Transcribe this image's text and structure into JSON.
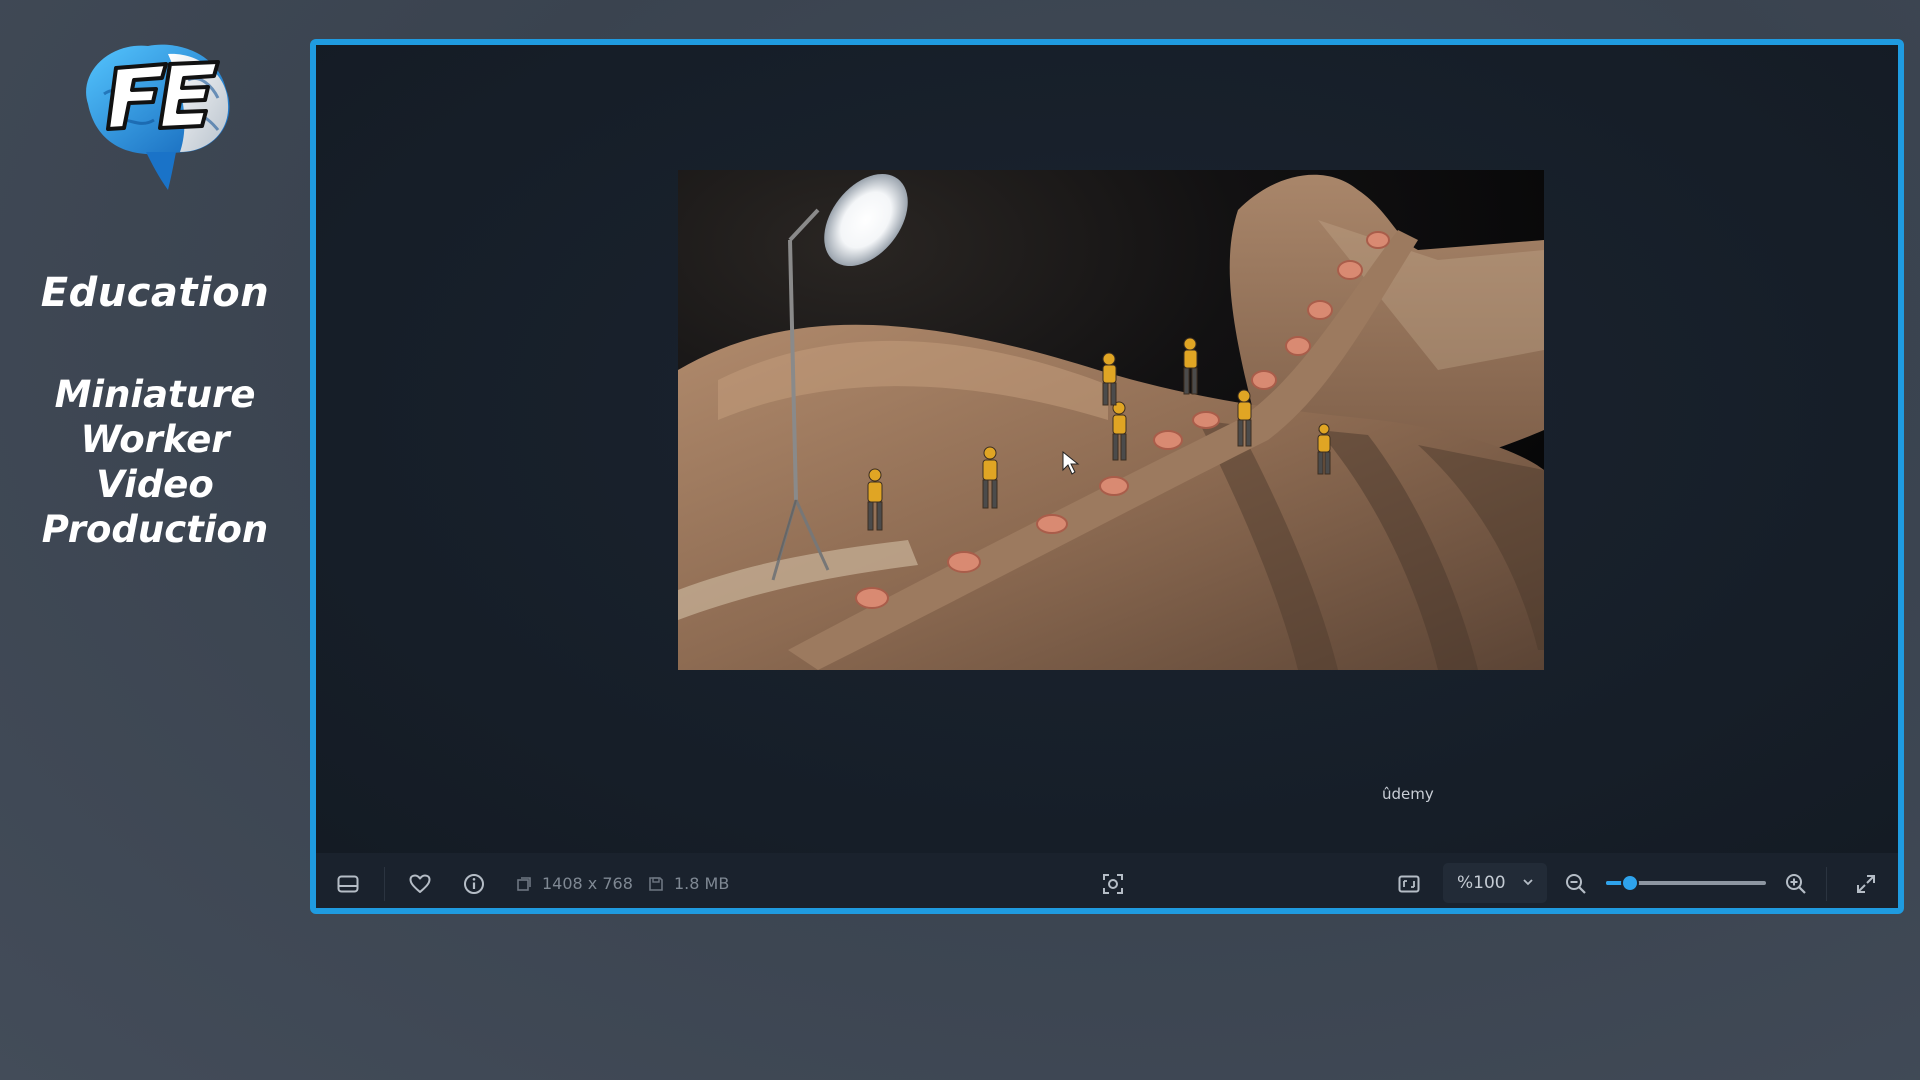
{
  "brand": {
    "logo_text": "FE",
    "title": "Education",
    "subtitle_lines": [
      "Miniature",
      "Worker",
      "Video",
      "Production"
    ]
  },
  "viewer": {
    "watermark": "ûdemy",
    "photo_icon": "miniature-workers-on-dress-photo",
    "toolbar": {
      "filmstrip_icon": "filmstrip-icon",
      "favorite_icon": "heart-icon",
      "info_icon": "info-icon",
      "dimensions_icon": "dimensions-icon",
      "dimensions": "1408 x 768",
      "filesize_icon": "save-icon",
      "filesize": "1.8 MB",
      "center_icon": "face-frame-icon",
      "fit_icon": "fit-window-icon",
      "zoom_value": "%100",
      "zoom_out_icon": "zoom-out-icon",
      "zoom_in_icon": "zoom-in-icon",
      "zoom_level": 0.15,
      "fullscreen_icon": "expand-icon"
    }
  },
  "colors": {
    "accent": "#1f9be0",
    "frame_bg": "#18202b",
    "toolbar_bg": "#1a222d"
  }
}
